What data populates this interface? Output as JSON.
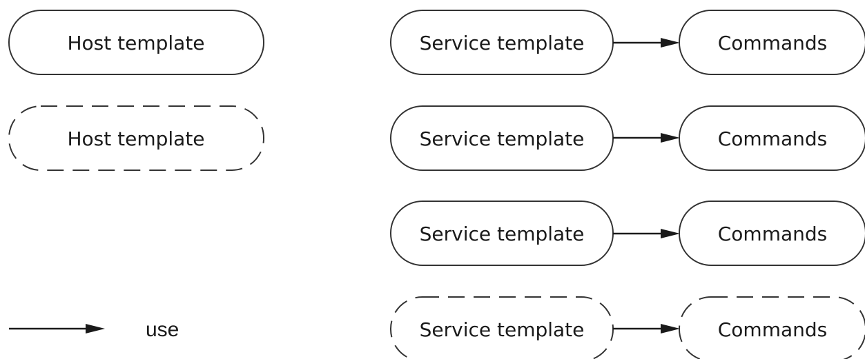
{
  "host_templates": [
    {
      "label": "Host template",
      "style": "solid"
    },
    {
      "label": "Host template",
      "style": "dashed"
    }
  ],
  "service_rows": [
    {
      "service": {
        "label": "Service template",
        "style": "solid"
      },
      "command": {
        "label": "Commands",
        "style": "solid"
      }
    },
    {
      "service": {
        "label": "Service template",
        "style": "solid"
      },
      "command": {
        "label": "Commands",
        "style": "solid"
      }
    },
    {
      "service": {
        "label": "Service template",
        "style": "solid"
      },
      "command": {
        "label": "Commands",
        "style": "solid"
      }
    },
    {
      "service": {
        "label": "Service template",
        "style": "dashed"
      },
      "command": {
        "label": "Commands",
        "style": "dashed"
      }
    }
  ],
  "legend": {
    "label": "use"
  },
  "colors": {
    "stroke": "#333333",
    "text": "#1a1a1a",
    "background": "#ffffff"
  }
}
